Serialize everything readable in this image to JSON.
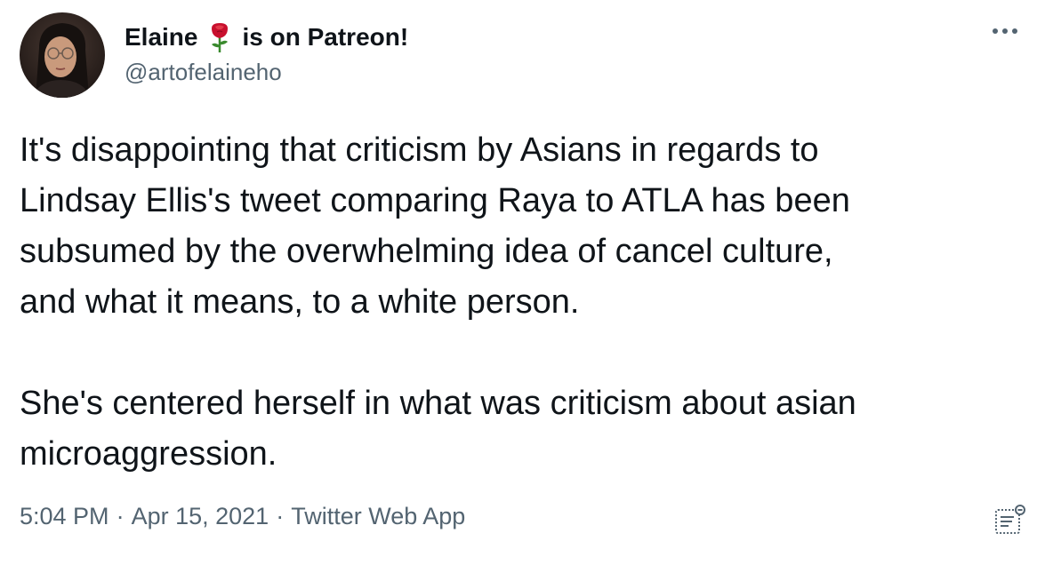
{
  "author": {
    "display_name_before": "Elaine",
    "display_name_after": "is on Patreon!",
    "handle": "@artofelaineho",
    "emoji_icon": "rose-icon"
  },
  "tweet": {
    "paragraphs": [
      "It's disappointing that criticism by Asians in regards to\nLindsay Ellis's tweet comparing Raya to ATLA has been\nsubsumed by the overwhelming idea of cancel culture,\nand what it means, to a white person.",
      "She's centered herself in what was criticism about asian\nmicroaggression."
    ]
  },
  "meta": {
    "time": "5:04 PM",
    "separator": "·",
    "date": "Apr 15, 2021",
    "source": "Twitter Web App"
  },
  "icons": {
    "more": "more-options-icon",
    "analytics": "analytics-icon"
  },
  "colors": {
    "text": "#0f1419",
    "secondary": "#536471",
    "rose": "#c8102e"
  }
}
